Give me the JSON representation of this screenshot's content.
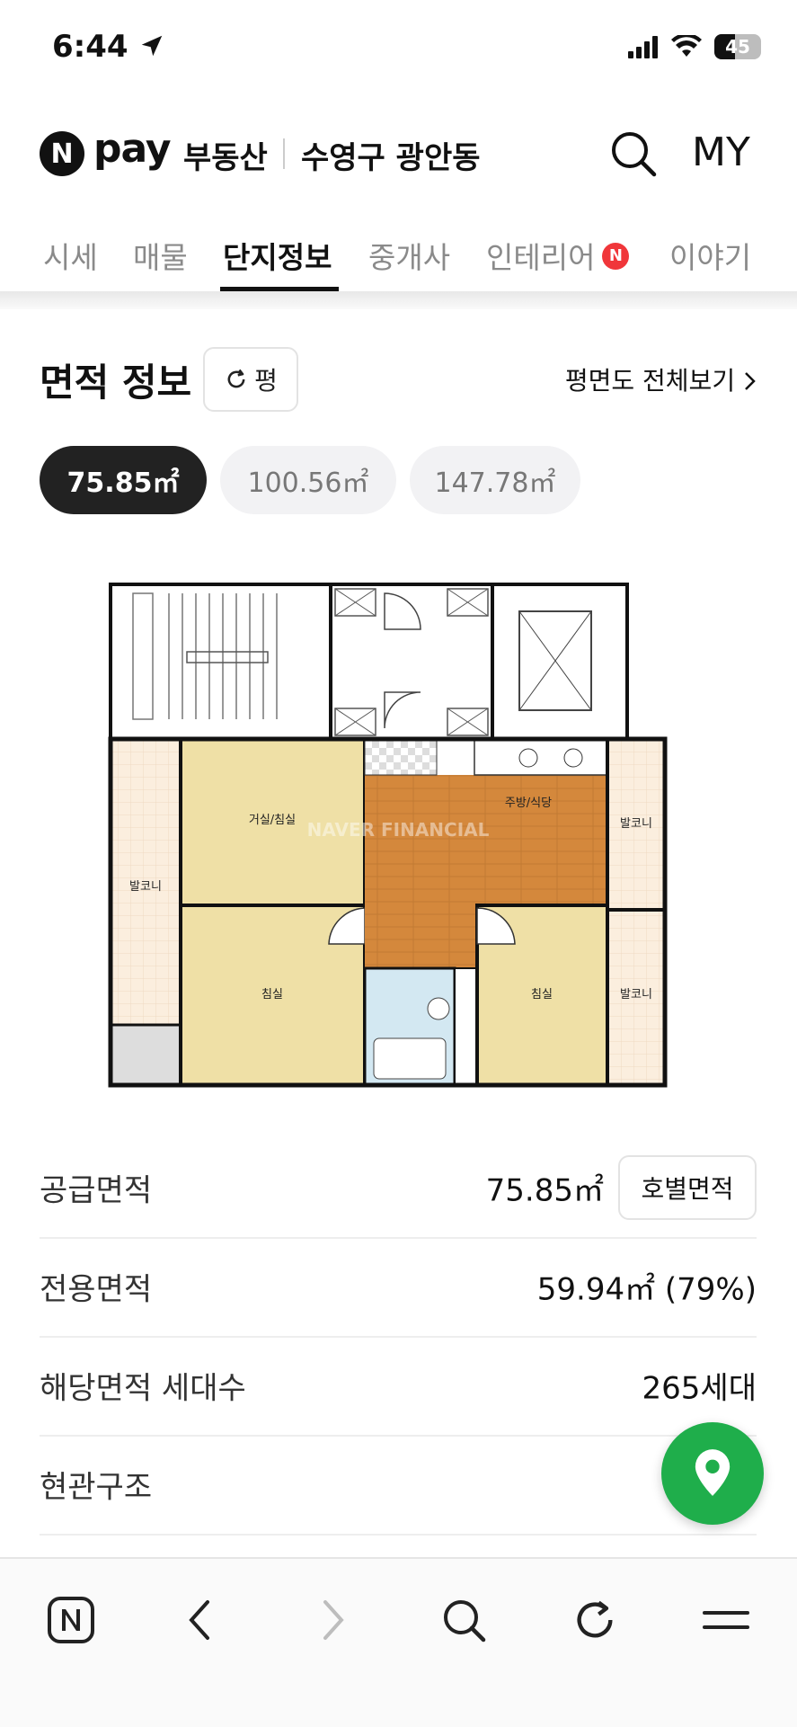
{
  "status_bar": {
    "time": "6:44",
    "battery": "45"
  },
  "header": {
    "logo_letter": "N",
    "logo_pay": "pay",
    "service": "부동산",
    "region": "수영구 광안동",
    "my_label": "MY"
  },
  "tabs": [
    {
      "label": "시세"
    },
    {
      "label": "매물"
    },
    {
      "label": "단지정보"
    },
    {
      "label": "중개사"
    },
    {
      "label": "인테리어",
      "badge": "N"
    },
    {
      "label": "이야기"
    }
  ],
  "section": {
    "title": "면적 정보",
    "unit_toggle": "평",
    "floorplan_link": "평면도 전체보기"
  },
  "area_chips": [
    {
      "label": "75.85㎡",
      "selected": true
    },
    {
      "label": "100.56㎡",
      "selected": false
    },
    {
      "label": "147.78㎡",
      "selected": false
    }
  ],
  "floor_plan": {
    "watermark": "NAVER FINANCIAL",
    "rooms": {
      "living": "거실/침실",
      "kitchen": "주방/식당",
      "balcony_left": "발코니",
      "balcony_right_top": "발코니",
      "balcony_right_bottom": "발코니",
      "bed_left": "침실",
      "bed_right": "침실"
    }
  },
  "info": {
    "supply": {
      "label": "공급면적",
      "value": "75.85㎡",
      "button": "호별면적"
    },
    "exclusive": {
      "label": "전용면적",
      "value": "59.94㎡ (79%)"
    },
    "households": {
      "label": "해당면적 세대수",
      "value": "265세대"
    },
    "structure": {
      "label": "현관구조",
      "value": ""
    }
  },
  "colors": {
    "accent_green": "#1fae4b",
    "badge_red": "#f0363a",
    "dark": "#222222"
  }
}
